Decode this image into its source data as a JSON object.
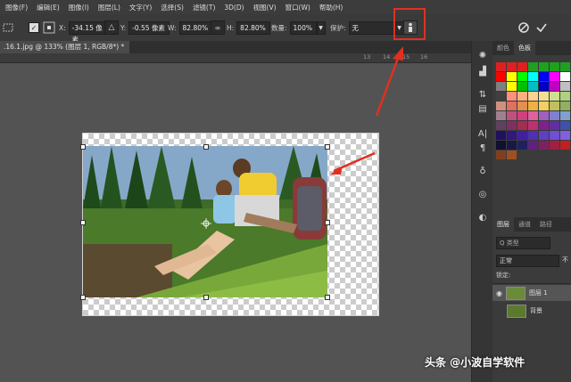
{
  "menubar": {
    "items": [
      "图像(F)",
      "编辑(E)",
      "图像(I)",
      "图层(L)",
      "文字(Y)",
      "选择(S)",
      "滤镜(T)",
      "3D(D)",
      "视图(V)",
      "窗口(W)",
      "帮助(H)"
    ]
  },
  "options": {
    "x_label": "X:",
    "x_value": "-34.15 像素",
    "y_label": "Y:",
    "y_value": "-0.55 像素",
    "w_label": "W:",
    "w_value": "82.80%",
    "h_label": "H:",
    "h_value": "82.80%",
    "amount_label": "数量:",
    "amount_value": "100%",
    "protect_label": "保护:",
    "protect_value": "无"
  },
  "document": {
    "tab_title": ".16.1.jpg @ 133% (图层 1, RGB/8*) *",
    "close": "×"
  },
  "ruler": {
    "labels": [
      "13",
      "14",
      "15",
      "16"
    ]
  },
  "panels": {
    "color_tabs": [
      "颜色",
      "色板"
    ],
    "layer_tabs": [
      "图层",
      "通道",
      "路径"
    ],
    "kind_label": "Q 类型",
    "blend_mode": "正常",
    "opacity_label": "不",
    "lock_label": "锁定:",
    "layers": [
      {
        "name": "图层 1"
      },
      {
        "name": "背景"
      }
    ],
    "swatch_colors": [
      [
        "#e02020",
        "#e02020",
        "#e02020",
        "#20a020",
        "#20a020",
        "#20a020",
        "#20a020"
      ],
      [
        "#ff0000",
        "#ffff00",
        "#00ff00",
        "#00ffff",
        "#0000ff",
        "#ff00ff",
        "#ffffff"
      ],
      [
        "#808080",
        "#ffff00",
        "#00c000",
        "#00c0c0",
        "#0000c0",
        "#c000c0",
        "#c0c0c0"
      ],
      [
        "#404040",
        "#ff9080",
        "#ffb080",
        "#ffd090",
        "#f0e090",
        "#d0e090",
        "#b0d080"
      ],
      [
        "#d09080",
        "#e07060",
        "#e09050",
        "#f0b040",
        "#f0d060",
        "#c0c060",
        "#90b060"
      ],
      [
        "#a08090",
        "#c05080",
        "#d04080",
        "#e060a0",
        "#a060c0",
        "#8080d0",
        "#80a0d0"
      ],
      [
        "#604060",
        "#803060",
        "#a03050",
        "#c03070",
        "#802090",
        "#6030a0",
        "#4050b0"
      ],
      [
        "#201060",
        "#301880",
        "#4020a0",
        "#5030b0",
        "#6040c0",
        "#7050d0",
        "#8060e0"
      ],
      [
        "#101030",
        "#181848",
        "#202060",
        "#602080",
        "#802060",
        "#a02040",
        "#c02020"
      ],
      [
        "#804020",
        "#a05020"
      ]
    ]
  },
  "watermark": "头条 @小波自学软件",
  "accent": "#e03020"
}
